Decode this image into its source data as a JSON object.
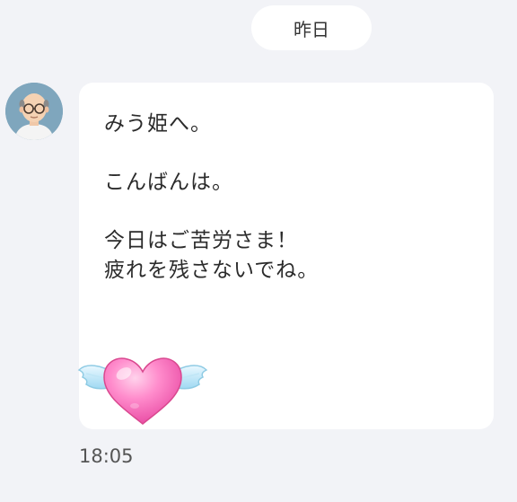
{
  "chat": {
    "date_label": "昨日",
    "message": {
      "text": "みう姫へ。\n\nこんばんは。\n\n今日はご苦労さま！\n疲れを残さないでね。",
      "time": "18:05",
      "sticker": "winged-heart-sticker"
    },
    "sender": {
      "avatar": "old-man-avatar"
    }
  }
}
